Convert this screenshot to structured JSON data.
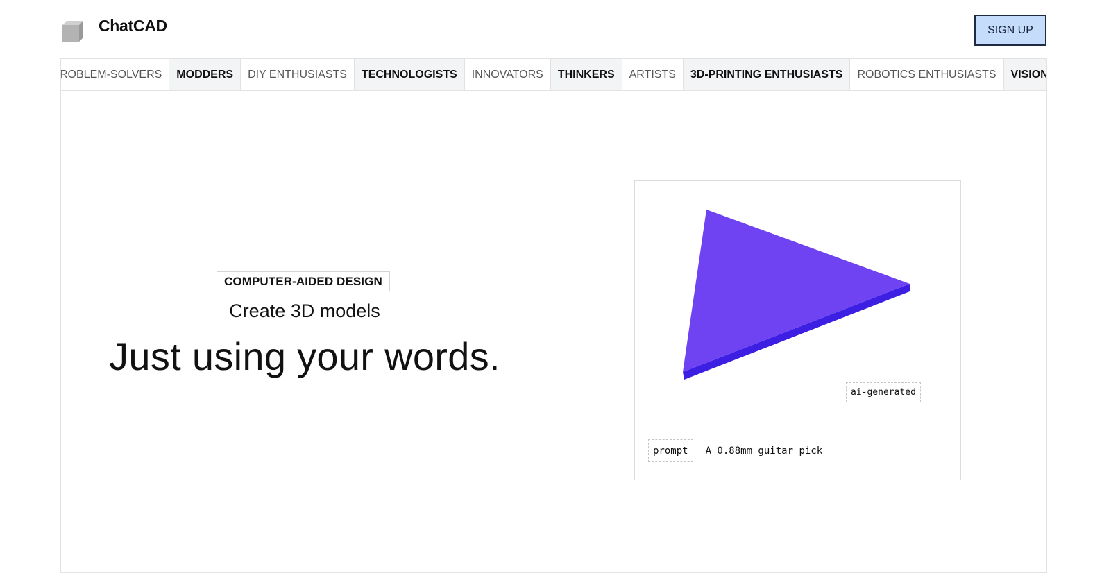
{
  "header": {
    "brand": "ChatCAD",
    "signup_label": "SIGN UP",
    "logo_icon": "cube-icon"
  },
  "audiences": [
    {
      "label": "ROBLEM-SOLVERS",
      "bold": false
    },
    {
      "label": "MODDERS",
      "bold": true
    },
    {
      "label": "DIY ENTHUSIASTS",
      "bold": false
    },
    {
      "label": "TECHNOLOGISTS",
      "bold": true
    },
    {
      "label": "INNOVATORS",
      "bold": false
    },
    {
      "label": "THINKERS",
      "bold": true
    },
    {
      "label": "ARTISTS",
      "bold": false
    },
    {
      "label": "3D-PRINTING ENTHUSIASTS",
      "bold": true
    },
    {
      "label": "ROBOTICS ENTHUSIASTS",
      "bold": false
    },
    {
      "label": "VISIONAR",
      "bold": true
    }
  ],
  "hero": {
    "eyebrow": "COMPUTER-AIDED DESIGN",
    "subhead": "Create 3D models",
    "headline": "Just using your words."
  },
  "preview": {
    "badge": "ai-generated",
    "prompt_label": "prompt",
    "prompt_text": "A 0.88mm guitar pick",
    "model_colors": {
      "top": "#6f42f2",
      "edge": "#3c1fe3"
    }
  },
  "colors": {
    "signup_bg": "#c6dcfb",
    "signup_border": "#1e2a44",
    "tag_bold_bg": "#f3f4f6"
  }
}
